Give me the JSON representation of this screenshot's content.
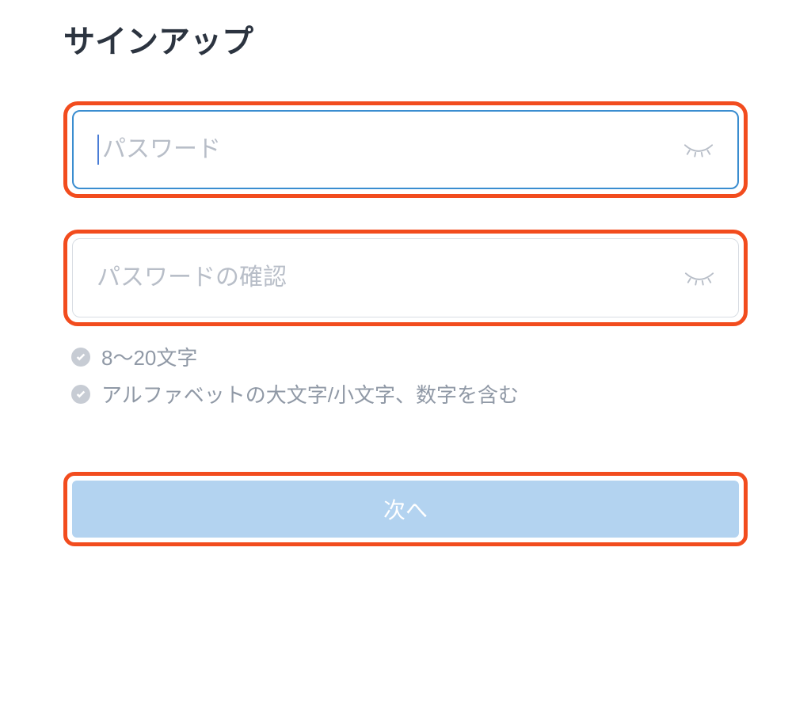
{
  "title": "サインアップ",
  "password": {
    "placeholder": "パスワード",
    "value": ""
  },
  "password_confirm": {
    "placeholder": "パスワードの確認",
    "value": ""
  },
  "requirements": [
    "8〜20文字",
    "アルファベットの大文字/小文字、数字を含む"
  ],
  "next_button": "次へ",
  "colors": {
    "highlight": "#f24c1e",
    "focus_border": "#3a8dd0",
    "button_bg": "#b3d3f0"
  }
}
